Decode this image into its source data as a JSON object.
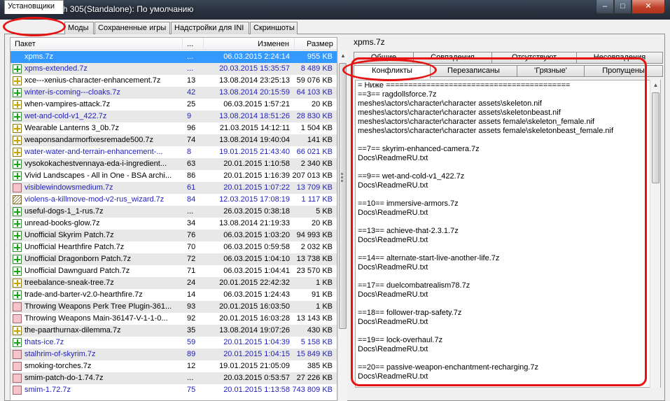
{
  "window": {
    "title": "Wrye Smash 305(Standalone): По умолчанию",
    "min": "–",
    "max": "□",
    "close": "✕"
  },
  "main_tabs": [
    "Установщики",
    "Моды",
    "Сохраненные игры",
    "Надстройки для INI",
    "Скриншоты"
  ],
  "list": {
    "headers": {
      "package": "Пакет",
      "num": "...",
      "modified": "Изменен",
      "size": "Размер"
    },
    "rows": [
      {
        "icon": "none",
        "name": "xpms.7z",
        "num": "...",
        "date": "06.03.2015 2:24:14",
        "size": "955 KB",
        "state": "sel"
      },
      {
        "icon": "green",
        "name": "xpms-extended.7z",
        "num": "...",
        "date": "20.03.2015 15:35:57",
        "size": "8 489 KB",
        "state": "blue"
      },
      {
        "icon": "yellow",
        "name": "xce---xenius-character-enhancement.7z",
        "num": "13",
        "date": "13.08.2014 23:25:13",
        "size": "59 076 KB",
        "state": ""
      },
      {
        "icon": "green",
        "name": "winter-is-coming---cloaks.7z",
        "num": "42",
        "date": "13.08.2014 20:15:59",
        "size": "64 103 KB",
        "state": "blue"
      },
      {
        "icon": "yellow",
        "name": "when-vampires-attack.7z",
        "num": "25",
        "date": "06.03.2015 1:57:21",
        "size": "20 KB",
        "state": ""
      },
      {
        "icon": "green",
        "name": "wet-and-cold-v1_422.7z",
        "num": "9",
        "date": "13.08.2014 18:51:26",
        "size": "28 830 KB",
        "state": "blue"
      },
      {
        "icon": "yellow",
        "name": "Wearable Lanterns 3_0b.7z",
        "num": "96",
        "date": "21.03.2015 14:12:11",
        "size": "1 504 KB",
        "state": ""
      },
      {
        "icon": "yellow",
        "name": "weaponsandarmorfixesremade500.7z",
        "num": "74",
        "date": "13.08.2014 19:40:04",
        "size": "141 KB",
        "state": ""
      },
      {
        "icon": "yellow",
        "name": "water-water-and-terrain-enhancement-...",
        "num": "8",
        "date": "19.01.2015 21:43:40",
        "size": "66 021 KB",
        "state": "blue"
      },
      {
        "icon": "green",
        "name": "vysokokachestvennaya-eda-i-ingredient...",
        "num": "63",
        "date": "20.01.2015 1:10:58",
        "size": "2 340 KB",
        "state": ""
      },
      {
        "icon": "green",
        "name": "Vivid Landscapes - All in One - BSA archi...",
        "num": "86",
        "date": "20.01.2015 1:16:39",
        "size": "207 013 KB",
        "state": ""
      },
      {
        "icon": "pink",
        "name": "visiblewindowsmedium.7z",
        "num": "61",
        "date": "20.01.2015 1:07:22",
        "size": "13 709 KB",
        "state": "blue"
      },
      {
        "icon": "hatch",
        "name": "violens-a-killmove-mod-v2-rus_wizard.7z",
        "num": "84",
        "date": "12.03.2015 17:08:19",
        "size": "1 117 KB",
        "state": "blue"
      },
      {
        "icon": "green",
        "name": "useful-dogs-1_1-rus.7z",
        "num": "...",
        "date": "26.03.2015 0:38:18",
        "size": "5 KB",
        "state": ""
      },
      {
        "icon": "green",
        "name": "unread-books-glow.7z",
        "num": "34",
        "date": "13.08.2014 21:19:33",
        "size": "20 KB",
        "state": ""
      },
      {
        "icon": "green",
        "name": "Unofficial Skyrim Patch.7z",
        "num": "76",
        "date": "06.03.2015 1:03:20",
        "size": "94 993 KB",
        "state": ""
      },
      {
        "icon": "green",
        "name": "Unofficial Hearthfire Patch.7z",
        "num": "70",
        "date": "06.03.2015 0:59:58",
        "size": "2 032 KB",
        "state": ""
      },
      {
        "icon": "green",
        "name": "Unofficial Dragonborn Patch.7z",
        "num": "72",
        "date": "06.03.2015 1:04:10",
        "size": "13 738 KB",
        "state": ""
      },
      {
        "icon": "green",
        "name": "Unofficial Dawnguard Patch.7z",
        "num": "71",
        "date": "06.03.2015 1:04:41",
        "size": "23 570 KB",
        "state": ""
      },
      {
        "icon": "yellow",
        "name": "treebalance-sneak-tree.7z",
        "num": "24",
        "date": "20.01.2015 22:42:32",
        "size": "1 KB",
        "state": ""
      },
      {
        "icon": "green",
        "name": "trade-and-barter-v2.0-hearthfire.7z",
        "num": "14",
        "date": "06.03.2015 1:24:43",
        "size": "91 KB",
        "state": ""
      },
      {
        "icon": "pink",
        "name": "Throwing Weapons Perk Tree Plugin-361...",
        "num": "93",
        "date": "20.01.2015 16:03:50",
        "size": "1 KB",
        "state": ""
      },
      {
        "icon": "pink",
        "name": "Throwing Weapons Main-36147-V-1-1-0...",
        "num": "92",
        "date": "20.01.2015 16:03:28",
        "size": "13 143 KB",
        "state": ""
      },
      {
        "icon": "yellow",
        "name": "the-paarthurnax-dilemma.7z",
        "num": "35",
        "date": "13.08.2014 19:07:26",
        "size": "430 KB",
        "state": ""
      },
      {
        "icon": "green",
        "name": "thats-ice.7z",
        "num": "59",
        "date": "20.01.2015 1:04:39",
        "size": "5 158 KB",
        "state": "blue"
      },
      {
        "icon": "pink",
        "name": "stalhrim-of-skyrim.7z",
        "num": "89",
        "date": "20.01.2015 1:04:15",
        "size": "15 849 KB",
        "state": "blue"
      },
      {
        "icon": "pink",
        "name": "smoking-torches.7z",
        "num": "12",
        "date": "19.01.2015 21:05:09",
        "size": "385 KB",
        "state": ""
      },
      {
        "icon": "pink",
        "name": "smim-patch-do-1.74.7z",
        "num": "...",
        "date": "20.03.2015 0:53:57",
        "size": "27 226 KB",
        "state": ""
      },
      {
        "icon": "pink",
        "name": "smim-1.72.7z",
        "num": "75",
        "date": "20.01.2015 1:13:58",
        "size": "743 809 KB",
        "state": "blue"
      }
    ]
  },
  "details": {
    "package_name": "xpms.7z",
    "tabs_row1": [
      "Общие",
      "Совпадения",
      "Отсутствуют",
      "Несовпадения"
    ],
    "tabs_row2": [
      "Конфликты",
      "Перезаписаны",
      "'Грязные'",
      "Пропущены"
    ],
    "active_tab": "Конфликты",
    "lines": [
      "= Ниже =========================================",
      "==3== ragdollsforce.7z",
      "meshes\\actors\\character\\character assets\\skeleton.nif",
      "meshes\\actors\\character\\character assets\\skeletonbeast.nif",
      "meshes\\actors\\character\\character assets female\\skeleton_female.nif",
      "meshes\\actors\\character\\character assets female\\skeletonbeast_female.nif",
      "",
      "==7== skyrim-enhanced-camera.7z",
      "Docs\\ReadmeRU.txt",
      "",
      "==9== wet-and-cold-v1_422.7z",
      "Docs\\ReadmeRU.txt",
      "",
      "==10== immersive-armors.7z",
      "Docs\\ReadmeRU.txt",
      "",
      "==13== achieve-that-2.3.1.7z",
      "Docs\\ReadmeRU.txt",
      "",
      "==14== alternate-start-live-another-life.7z",
      "Docs\\ReadmeRU.txt",
      "",
      "==17== duelcombatrealism78.7z",
      "Docs\\ReadmeRU.txt",
      "",
      "==18== follower-trap-safety.7z",
      "Docs\\ReadmeRU.txt",
      "",
      "==19== lock-overhaul.7z",
      "Docs\\ReadmeRU.txt",
      "",
      "==20== passive-weapon-enchantment-recharging.7z",
      "Docs\\ReadmeRU.txt"
    ]
  },
  "scroll_icons": {
    "up": "▲",
    "down": "▼"
  },
  "colors": {
    "selection": "#3399ff",
    "link_blue": "#1f1fb8",
    "annotation_red": "#e81212"
  }
}
